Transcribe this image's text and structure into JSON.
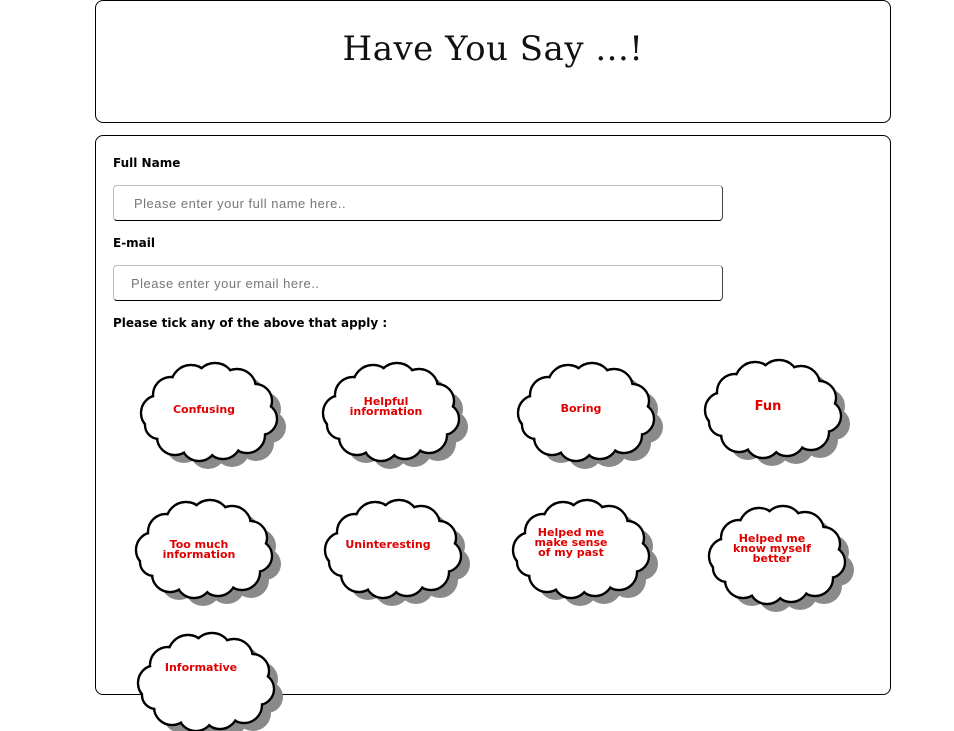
{
  "header": {
    "title": "Have You Say ...!"
  },
  "form": {
    "full_name": {
      "label": "Full Name",
      "placeholder": "Please enter your full name here.."
    },
    "email": {
      "label": "E-mail",
      "placeholder": "Please enter your email here.."
    },
    "tick_prompt": "Please tick any of the above that apply :"
  },
  "options": [
    {
      "label": "Confusing"
    },
    {
      "label": "Helpful\ninformation"
    },
    {
      "label": "Boring"
    },
    {
      "label": "Fun"
    },
    {
      "label": "Too much\ninformation"
    },
    {
      "label": "Uninteresting"
    },
    {
      "label": "Helped me\nmake sense\nof my past"
    },
    {
      "label": "Helped me\nknow myself\nbetter"
    },
    {
      "label": "Informative"
    }
  ],
  "colors": {
    "label_red": "#e00000",
    "border": "#000000",
    "cloud_shadow": "#8a8a8a"
  }
}
